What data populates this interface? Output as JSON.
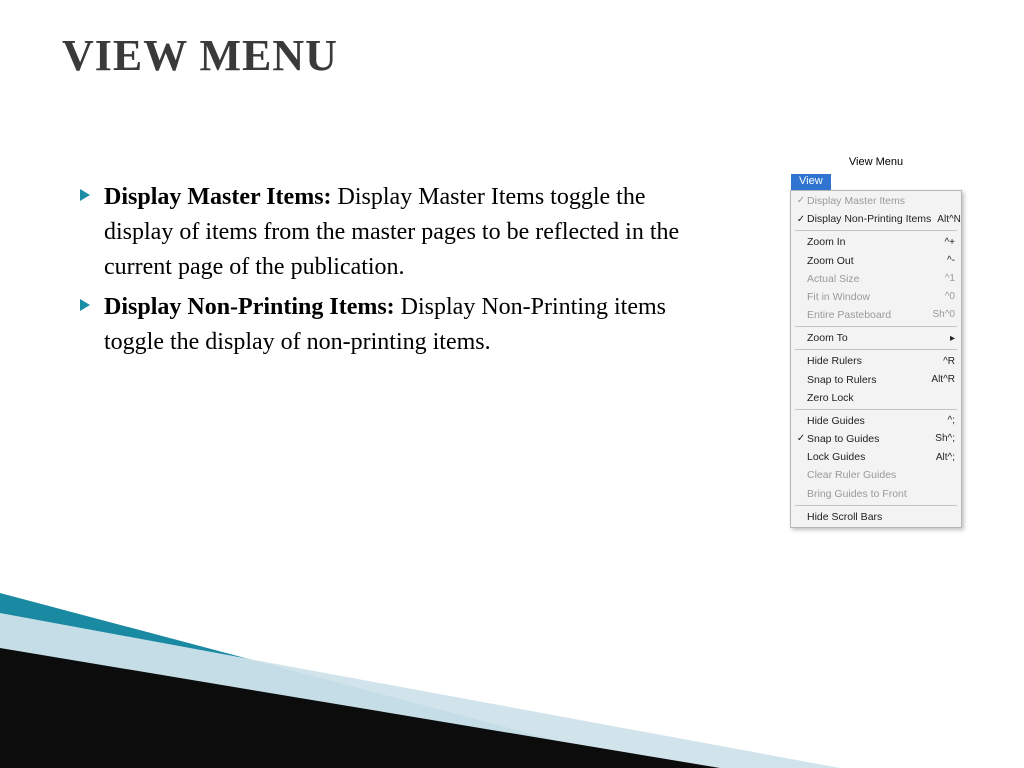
{
  "title": "VIEW MENU",
  "bullets": [
    {
      "label": "Display Master Items:",
      "text": " Display Master Items toggle the display of items from the master pages to be reflected in the current page of the publication."
    },
    {
      "label": "Display Non-Printing Items:",
      "text": " Display Non-Printing items toggle the display of non-printing items."
    }
  ],
  "menu": {
    "caption": "View Menu",
    "tab": "View",
    "groups": [
      [
        {
          "check": true,
          "label": "Display Master Items",
          "shortcut": "",
          "disabled": true
        },
        {
          "check": true,
          "label": "Display Non-Printing Items",
          "shortcut": "Alt^N",
          "disabled": false
        }
      ],
      [
        {
          "check": false,
          "label": "Zoom In",
          "shortcut": "^+",
          "disabled": false
        },
        {
          "check": false,
          "label": "Zoom Out",
          "shortcut": "^-",
          "disabled": false
        },
        {
          "check": false,
          "label": "Actual Size",
          "shortcut": "^1",
          "disabled": true
        },
        {
          "check": false,
          "label": "Fit in Window",
          "shortcut": "^0",
          "disabled": true
        },
        {
          "check": false,
          "label": "Entire Pasteboard",
          "shortcut": "Sh^0",
          "disabled": true
        }
      ],
      [
        {
          "check": false,
          "label": "Zoom To",
          "shortcut": "",
          "submenu": true,
          "disabled": false
        }
      ],
      [
        {
          "check": false,
          "label": "Hide Rulers",
          "shortcut": "^R",
          "disabled": false
        },
        {
          "check": false,
          "label": "Snap to Rulers",
          "shortcut": "Alt^R",
          "disabled": false
        },
        {
          "check": false,
          "label": "Zero Lock",
          "shortcut": "",
          "disabled": false
        }
      ],
      [
        {
          "check": false,
          "label": "Hide Guides",
          "shortcut": "^;",
          "disabled": false
        },
        {
          "check": true,
          "label": "Snap to Guides",
          "shortcut": "Sh^;",
          "disabled": false
        },
        {
          "check": false,
          "label": "Lock Guides",
          "shortcut": "Alt^;",
          "disabled": false
        },
        {
          "check": false,
          "label": "Clear Ruler Guides",
          "shortcut": "",
          "disabled": true
        },
        {
          "check": false,
          "label": "Bring Guides to Front",
          "shortcut": "",
          "disabled": true
        }
      ],
      [
        {
          "check": false,
          "label": "Hide Scroll Bars",
          "shortcut": "",
          "disabled": false
        }
      ]
    ]
  }
}
